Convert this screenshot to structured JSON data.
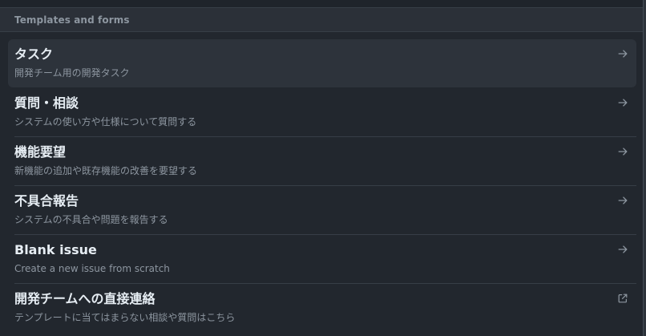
{
  "section": {
    "title": "Templates and forms"
  },
  "templates": [
    {
      "title": "タスク",
      "description": "開発チーム用の開発タスク",
      "icon": "arrow-right-icon"
    },
    {
      "title": "質問・相談",
      "description": "システムの使い方や仕様について質問する",
      "icon": "arrow-right-icon"
    },
    {
      "title": "機能要望",
      "description": "新機能の追加や既存機能の改善を要望する",
      "icon": "arrow-right-icon"
    },
    {
      "title": "不具合報告",
      "description": "システムの不具合や問題を報告する",
      "icon": "arrow-right-icon"
    },
    {
      "title": "Blank issue",
      "description": "Create a new issue from scratch",
      "icon": "arrow-right-icon"
    },
    {
      "title": "開発チームへの直接連絡",
      "description": "テンプレートに当てはまらない相談や質問はこちら",
      "icon": "link-external-icon"
    }
  ],
  "colors": {
    "background": "#22272e",
    "hover": "#2d333b",
    "title": "#e6edf3",
    "muted": "#8d96a0",
    "border": "#373e47"
  }
}
